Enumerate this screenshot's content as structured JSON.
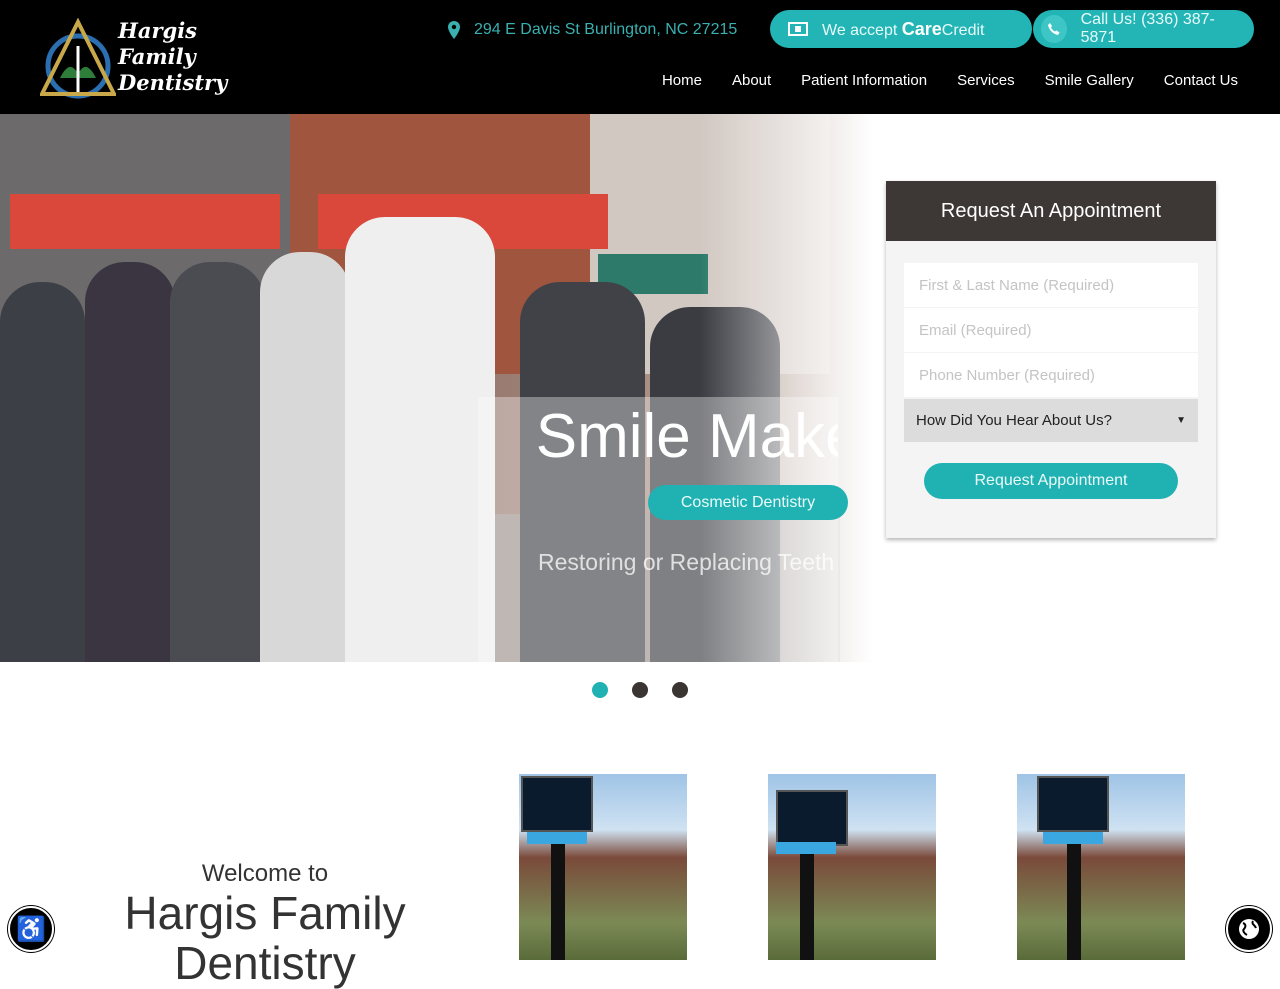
{
  "brand": {
    "logo_text": [
      "Hargis",
      "Family",
      "Dentistry"
    ],
    "accent": "#20b2b2"
  },
  "header": {
    "address": "294 E Davis St Burlington, NC 27215",
    "carecredit": {
      "prefix": "We accept",
      "brand_bold": "Care",
      "brand_rest": "Credit"
    },
    "call": "Call Us! (336) 387-5871",
    "nav": [
      "Home",
      "About",
      "Patient Information",
      "Services",
      "Smile Gallery",
      "Contact Us"
    ]
  },
  "hero": {
    "title": "Smile Makeover",
    "subtitle": "Restoring or Replacing Teeth",
    "cta": "Cosmetic Dentistry",
    "slides": 3,
    "active_slide": 1
  },
  "form": {
    "title": "Request An Appointment",
    "name_placeholder": "First & Last Name (Required)",
    "email_placeholder": "Email (Required)",
    "phone_placeholder": "Phone Number (Required)",
    "source_select": "How Did You Hear About Us?",
    "submit": "Request Appointment"
  },
  "welcome": {
    "small": "Welcome to",
    "large": "Hargis Family Dentistry"
  },
  "icons": {
    "accessibility": "accessibility-icon",
    "language": "globe-icon"
  }
}
